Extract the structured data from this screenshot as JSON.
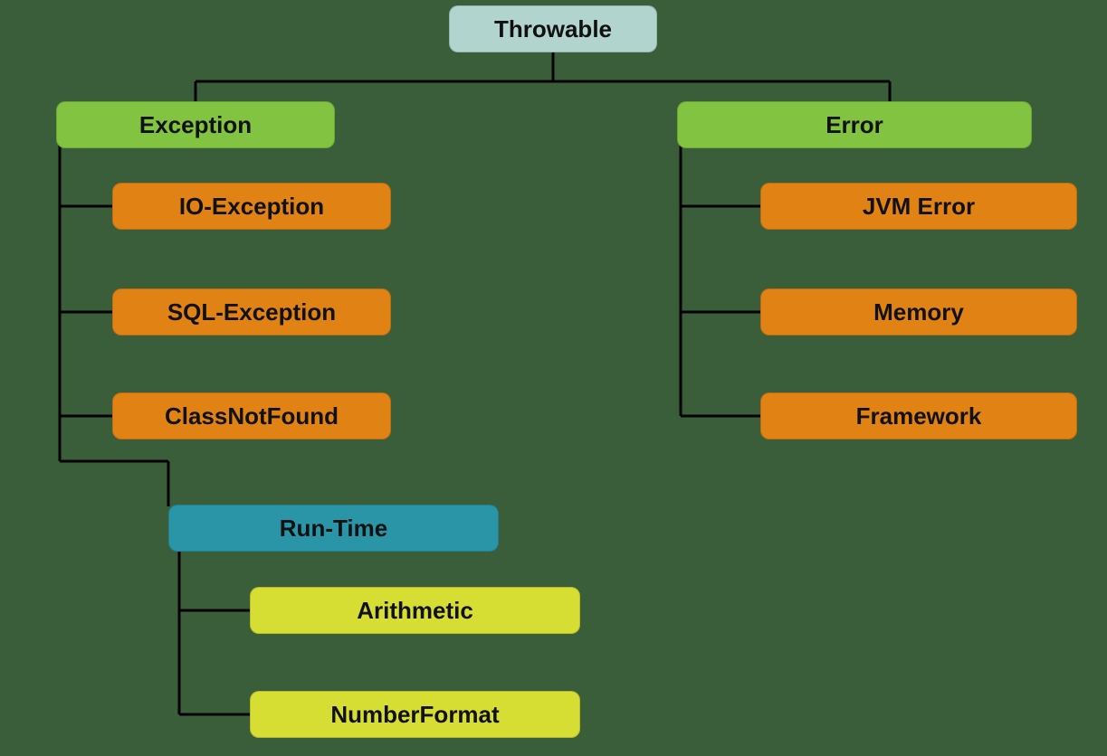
{
  "root": {
    "label": "Throwable"
  },
  "left": {
    "label": "Exception",
    "children": [
      {
        "label": "IO-Exception"
      },
      {
        "label": "SQL-Exception"
      },
      {
        "label": "ClassNotFound"
      },
      {
        "label": "Run-Time",
        "children": [
          {
            "label": "Arithmetic"
          },
          {
            "label": "NumberFormat"
          }
        ]
      }
    ]
  },
  "right": {
    "label": "Error",
    "children": [
      {
        "label": "JVM Error"
      },
      {
        "label": "Memory"
      },
      {
        "label": "Framework"
      }
    ]
  },
  "colors": {
    "root": "#b2d4ce",
    "category": "#82c341",
    "exception_child": "#e08214",
    "runtime": "#2b95a8",
    "runtime_child": "#d6dd33",
    "background": "#3a5e3a"
  }
}
